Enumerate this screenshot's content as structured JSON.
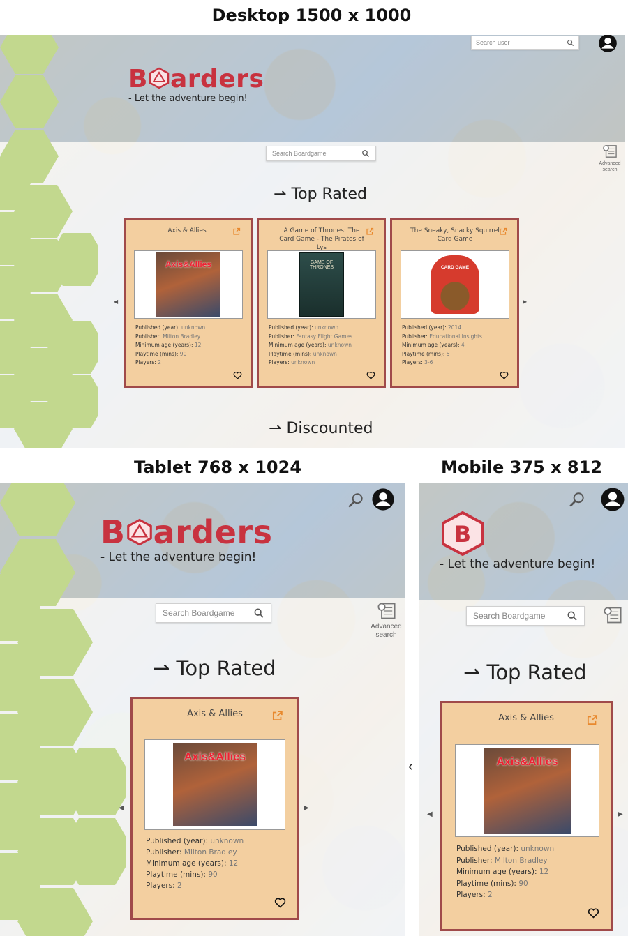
{
  "captions": {
    "desktop": "Desktop 1500 x 1000",
    "tablet": "Tablet 768 x 1024",
    "mobile": "Mobile 375 x 812"
  },
  "brand": {
    "name_before": "B",
    "name_after": "arders",
    "tagline": "- Let the adventure begin!",
    "color": "#c8323f"
  },
  "search_user": {
    "placeholder": "Search user"
  },
  "search_boardgame": {
    "placeholder": "Search Boardgame"
  },
  "advanced_search": {
    "label_line1": "Advanced",
    "label_line2": "search"
  },
  "sections": {
    "top_rated": "Top Rated",
    "discounted": "Discounted",
    "arrow": "⇀"
  },
  "labels": {
    "published": "Published (year):",
    "publisher": "Publisher:",
    "min_age": "Minimum age (years):",
    "playtime": "Playtime (mins):",
    "players": "Players:"
  },
  "games": [
    {
      "title": "Axis & Allies",
      "published": "unknown",
      "publisher": "Milton Bradley",
      "min_age": "12",
      "playtime": "90",
      "players": "2",
      "box_text": "Axis&Allies"
    },
    {
      "title": "A Game of Thrones: The Card Game - The Pirates of Lys",
      "published": "unknown",
      "publisher": "Fantasy Flight Games",
      "min_age": "unknown",
      "playtime": "unknown",
      "players": "unknown",
      "box_text": "GAME OF THRONES"
    },
    {
      "title": "The Sneaky, Snacky Squirrel Card Game",
      "published": "2014",
      "publisher": "Educational Insights",
      "min_age": "4",
      "playtime": "5",
      "players": "3-6",
      "box_text": "CARD GAME"
    }
  ],
  "colors": {
    "card_bg": "#f3cfa0",
    "card_border": "#a04a4a",
    "hex_green": "#c2d88e"
  }
}
